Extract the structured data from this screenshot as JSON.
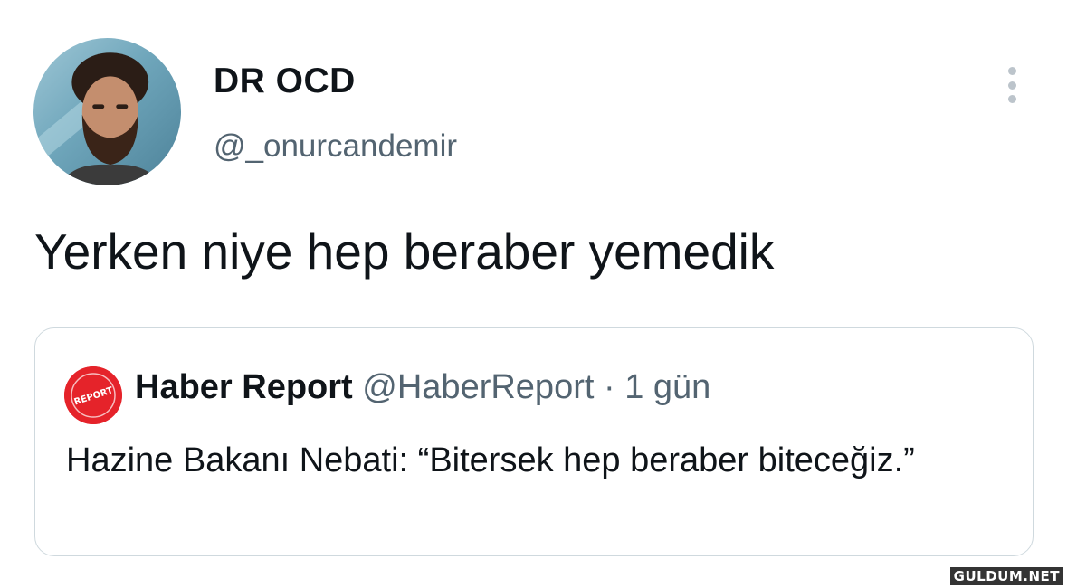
{
  "author": {
    "name": "DR OCD",
    "handle": "@_onurcandemir"
  },
  "tweet": {
    "text": "Yerken niye hep beraber yemedik"
  },
  "quoted": {
    "name": "Haber Report",
    "handle": "@HaberReport",
    "separator": "·",
    "time": "1 gün",
    "logo_text": "REPORT",
    "text": "Hazine Bakanı Nebati: “Bitersek hep beraber biteceğiz.”"
  },
  "watermark": "GULDUM.NET",
  "colors": {
    "primary_text": "#0f1419",
    "secondary_text": "#536471",
    "border": "#cfd9de",
    "logo_red": "#e5232a"
  },
  "icons": {
    "more": "more-options-icon"
  }
}
